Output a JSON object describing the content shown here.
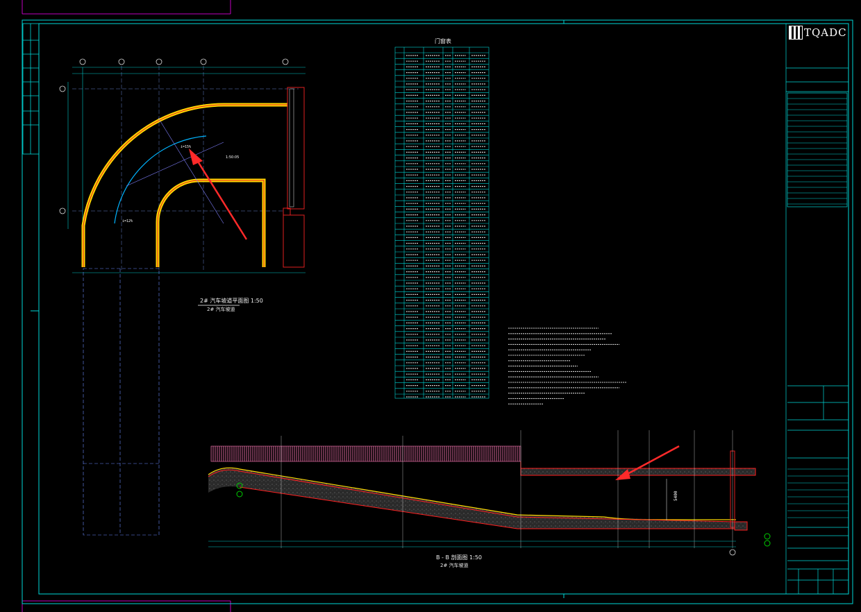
{
  "drawing": {
    "plan_title": "2# 汽车坡道平面图 1:50",
    "plan_subtitle": "2# 汽车坡道",
    "section_title": "B - B 剖面图 1:50",
    "section_subtitle": "2# 汽车坡道",
    "door_schedule_title": "门窗表"
  },
  "title_block": {
    "company_logo": "TQADC"
  },
  "colors": {
    "frame": "#00e5e5",
    "wall_red": "#ff2020",
    "wall_yellow": "#ffd800",
    "annotation_arrow": "#ff2a2a",
    "hatch_pink": "#ff7ab8",
    "background": "#000000"
  }
}
